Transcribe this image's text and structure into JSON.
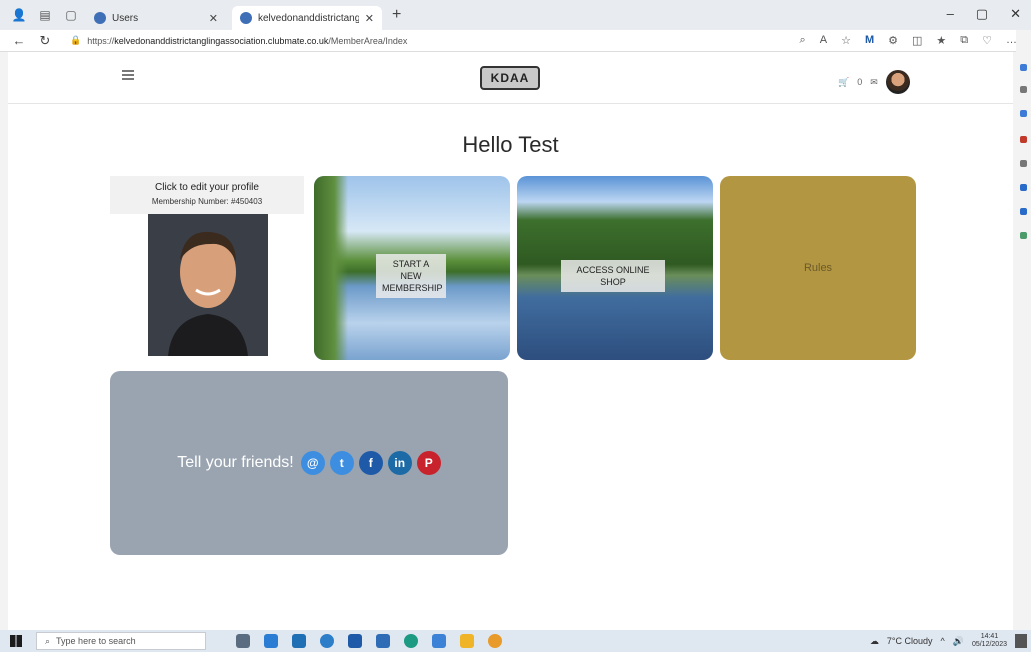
{
  "browser": {
    "tabs": [
      {
        "title": "Users",
        "active": false
      },
      {
        "title": "kelvedonanddistrictanglingassoci",
        "active": true
      }
    ],
    "new_tab": "+",
    "url_prefix": "https://",
    "url_host": "kelvedonanddistrictanglingassociation.clubmate.co.uk",
    "url_path": "/MemberArea/Index",
    "window_controls": [
      "–",
      "▢",
      "✕"
    ]
  },
  "site": {
    "logo_text": "KDAA",
    "basket_count": "0"
  },
  "main": {
    "greeting": "Hello Test",
    "profile": {
      "edit_text": "Click to edit your profile",
      "membership_number": "Membership Number: #450403"
    },
    "tiles": [
      {
        "label": "START A NEW MEMBERSHIP"
      },
      {
        "label": "ACCESS ONLINE SHOP"
      },
      {
        "label": "Rules"
      }
    ],
    "share": {
      "text": "Tell your friends!",
      "icons": [
        "email-icon",
        "twitter-icon",
        "facebook-icon",
        "linkedin-icon",
        "pinterest-icon"
      ]
    }
  },
  "taskbar": {
    "search_placeholder": "Type here to search",
    "weather": "7°C  Cloudy",
    "time": "14:41",
    "date": "05/12/2023"
  },
  "colors": {
    "rules_tile": "#b39641",
    "share_panel": "#9aa4b1",
    "pinterest": "#c8232c",
    "facebook": "#1f5aa8"
  }
}
